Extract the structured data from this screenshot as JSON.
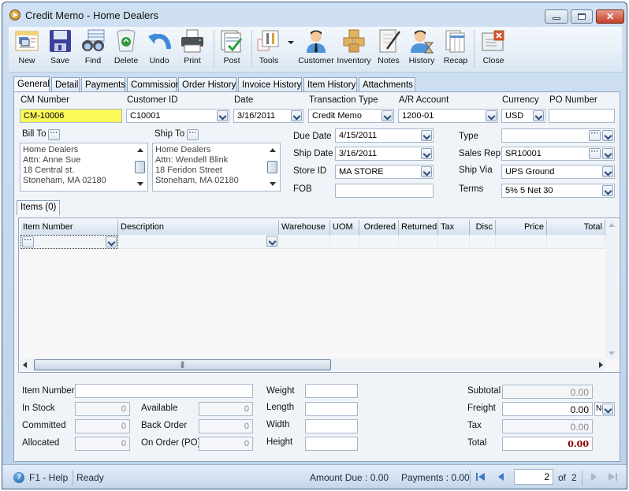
{
  "window": {
    "title": "Credit Memo - Home Dealers"
  },
  "toolbar": {
    "buttons": [
      {
        "id": "new",
        "label": "New",
        "icon": "new-document-icon"
      },
      {
        "id": "save",
        "label": "Save",
        "icon": "floppy-disk-icon"
      },
      {
        "id": "find",
        "label": "Find",
        "icon": "binoculars-icon"
      },
      {
        "id": "delete",
        "label": "Delete",
        "icon": "recycle-bin-icon"
      },
      {
        "id": "undo",
        "label": "Undo",
        "icon": "undo-arrow-icon"
      },
      {
        "id": "print",
        "label": "Print",
        "icon": "printer-icon"
      },
      {
        "id": "post",
        "label": "Post",
        "icon": "post-checkmark-icon"
      },
      {
        "id": "tools",
        "label": "Tools",
        "icon": "tools-icon"
      },
      {
        "id": "customer",
        "label": "Customer",
        "icon": "customer-person-icon"
      },
      {
        "id": "inventory",
        "label": "Inventory",
        "icon": "boxes-icon"
      },
      {
        "id": "notes",
        "label": "Notes",
        "icon": "notepad-pen-icon"
      },
      {
        "id": "history",
        "label": "History",
        "icon": "person-hourglass-icon"
      },
      {
        "id": "recap",
        "label": "Recap",
        "icon": "recap-document-icon"
      },
      {
        "id": "close",
        "label": "Close",
        "icon": "close-window-icon"
      }
    ]
  },
  "tabs": [
    "General",
    "Detail",
    "Payments",
    "Commission",
    "Order History",
    "Invoice History",
    "Item History",
    "Attachments"
  ],
  "active_tab": "General",
  "header": {
    "cm_number": {
      "label": "CM Number",
      "value": "CM-10006"
    },
    "customer_id": {
      "label": "Customer ID",
      "value": "C10001"
    },
    "date": {
      "label": "Date",
      "value": "3/16/2011"
    },
    "transaction_type": {
      "label": "Transaction Type",
      "value": "Credit Memo"
    },
    "ar_account": {
      "label": "A/R Account",
      "value": "1200-01"
    },
    "currency": {
      "label": "Currency",
      "value": "USD"
    },
    "po_number": {
      "label": "PO Number",
      "value": ""
    }
  },
  "bill_to": {
    "label": "Bill To",
    "lines": [
      "Home Dealers",
      "Attn: Anne Sue",
      "18 Central st.",
      "Stoneham, MA 02180"
    ]
  },
  "ship_to": {
    "label": "Ship To",
    "lines": [
      "Home Dealers",
      "Attn: Wendell Blink",
      "18 Feridon Street",
      "Stoneham, MA 02180"
    ]
  },
  "details": {
    "due_date": {
      "label": "Due Date",
      "value": "4/15/2011"
    },
    "ship_date": {
      "label": "Ship Date",
      "value": "3/16/2011"
    },
    "store_id": {
      "label": "Store ID",
      "value": "MA STORE"
    },
    "fob": {
      "label": "FOB",
      "value": ""
    },
    "type": {
      "label": "Type",
      "value": ""
    },
    "sales_rep": {
      "label": "Sales Rep",
      "value": "SR10001"
    },
    "ship_via": {
      "label": "Ship Via",
      "value": "UPS Ground"
    },
    "terms": {
      "label": "Terms",
      "value": "5% 5 Net 30"
    }
  },
  "items": {
    "tab_label": "Items (0)",
    "columns": [
      "Item Number",
      "Description",
      "Warehouse",
      "UOM",
      "Ordered",
      "Returned",
      "Tax",
      "Disc",
      "Price",
      "Total"
    ],
    "rows": []
  },
  "item_info": {
    "item_number": {
      "label": "Item Number",
      "value": ""
    },
    "in_stock": {
      "label": "In Stock",
      "value": "0"
    },
    "committed": {
      "label": "Committed",
      "value": "0"
    },
    "allocated": {
      "label": "Allocated",
      "value": "0"
    },
    "available": {
      "label": "Available",
      "value": "0"
    },
    "back_order": {
      "label": "Back Order",
      "value": "0"
    },
    "on_order": {
      "label": "On Order (PO)",
      "value": "0"
    },
    "weight": {
      "label": "Weight",
      "value": ""
    },
    "length": {
      "label": "Length",
      "value": ""
    },
    "width": {
      "label": "Width",
      "value": ""
    },
    "height": {
      "label": "Height",
      "value": ""
    }
  },
  "totals": {
    "subtotal": {
      "label": "Subtotal",
      "value": "0.00"
    },
    "freight": {
      "label": "Freight",
      "value": "0.00",
      "option": "No"
    },
    "tax": {
      "label": "Tax",
      "value": "0.00"
    },
    "total": {
      "label": "Total",
      "value": "0.00"
    },
    "total_color": "#8b0000"
  },
  "status": {
    "help": "F1 - Help",
    "state": "Ready",
    "amount_due": "Amount Due : 0.00",
    "payments": "Payments : 0.00",
    "page": "2",
    "of_label": "of",
    "page_count": "2"
  }
}
